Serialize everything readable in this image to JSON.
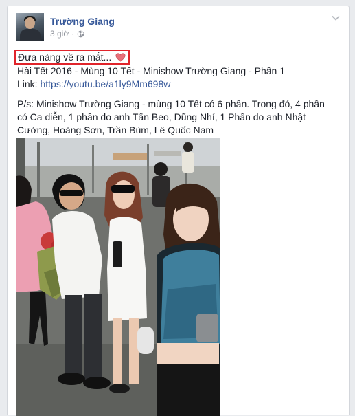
{
  "post": {
    "author": "Trường Giang",
    "time": "3 giờ",
    "time_separator": "·",
    "privacy_icon": "globe-icon",
    "menu_icon": "chevron-down-icon",
    "highlight_line": "Đưa nàng về ra mắt...",
    "highlight_emoji": "heart-icon",
    "title_line": "Hài Tết 2016 - Mùng 10 Tết - Minishow Trường Giang - Phần 1",
    "link_label": "Link:",
    "link_url": "https://youtu.be/a1ly9Mm698w",
    "body_lines": [
      "P/s: Minishow Trường Giang - mùng 10 Tết có 6 phần. Trong đó, 4 phần",
      "có Ca diễn, 1 phần do anh Tấn Beo, Dũng Nhí, 1 Phần do anh Nhật",
      "Cường, Hoàng Sơn, Trần Bùm, Lê Quốc Nam"
    ]
  },
  "colors": {
    "link": "#365899",
    "highlight_box": "#e0242b",
    "heart": "#e8707a"
  }
}
